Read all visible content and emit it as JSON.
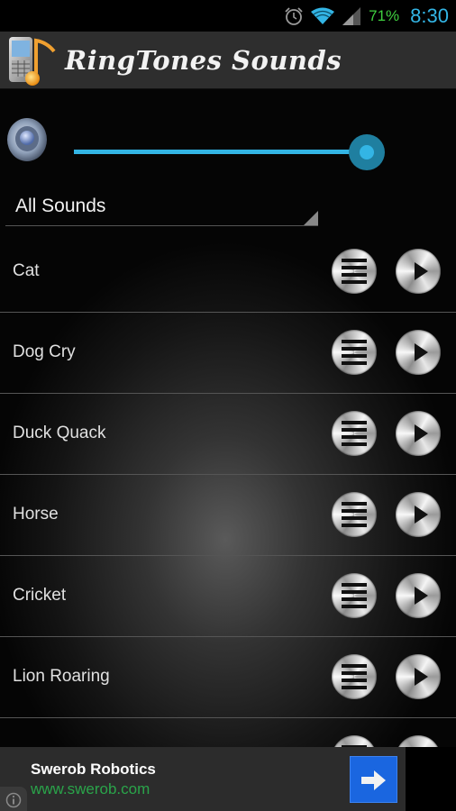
{
  "status_bar": {
    "battery": "71%",
    "time": "8:30",
    "icons": [
      "alarm-icon",
      "wifi-icon",
      "signal-icon"
    ],
    "colors": {
      "battery": "#3fcf3f",
      "time": "#33b5e5"
    }
  },
  "app": {
    "title": "RingTones Sounds",
    "logo_icon": "phone-music-note-icon"
  },
  "volume": {
    "icon": "speaker-icon",
    "level_fraction": 0.95,
    "accent": "#33b5e5"
  },
  "category": {
    "selected": "All Sounds"
  },
  "sounds": [
    {
      "name": "Cat"
    },
    {
      "name": "Dog Cry"
    },
    {
      "name": "Duck Quack"
    },
    {
      "name": "Horse"
    },
    {
      "name": "Cricket"
    },
    {
      "name": "Lion Roaring"
    },
    {
      "name": ""
    }
  ],
  "row_actions": {
    "menu_icon": "menu-lines-icon",
    "play_icon": "play-icon"
  },
  "ad": {
    "title": "Swerob Robotics",
    "url": "www.swerob.com",
    "go_icon": "arrow-right-icon",
    "info_icon": "info-icon",
    "colors": {
      "url": "#2aa44a",
      "button": "#1a66e0"
    }
  }
}
